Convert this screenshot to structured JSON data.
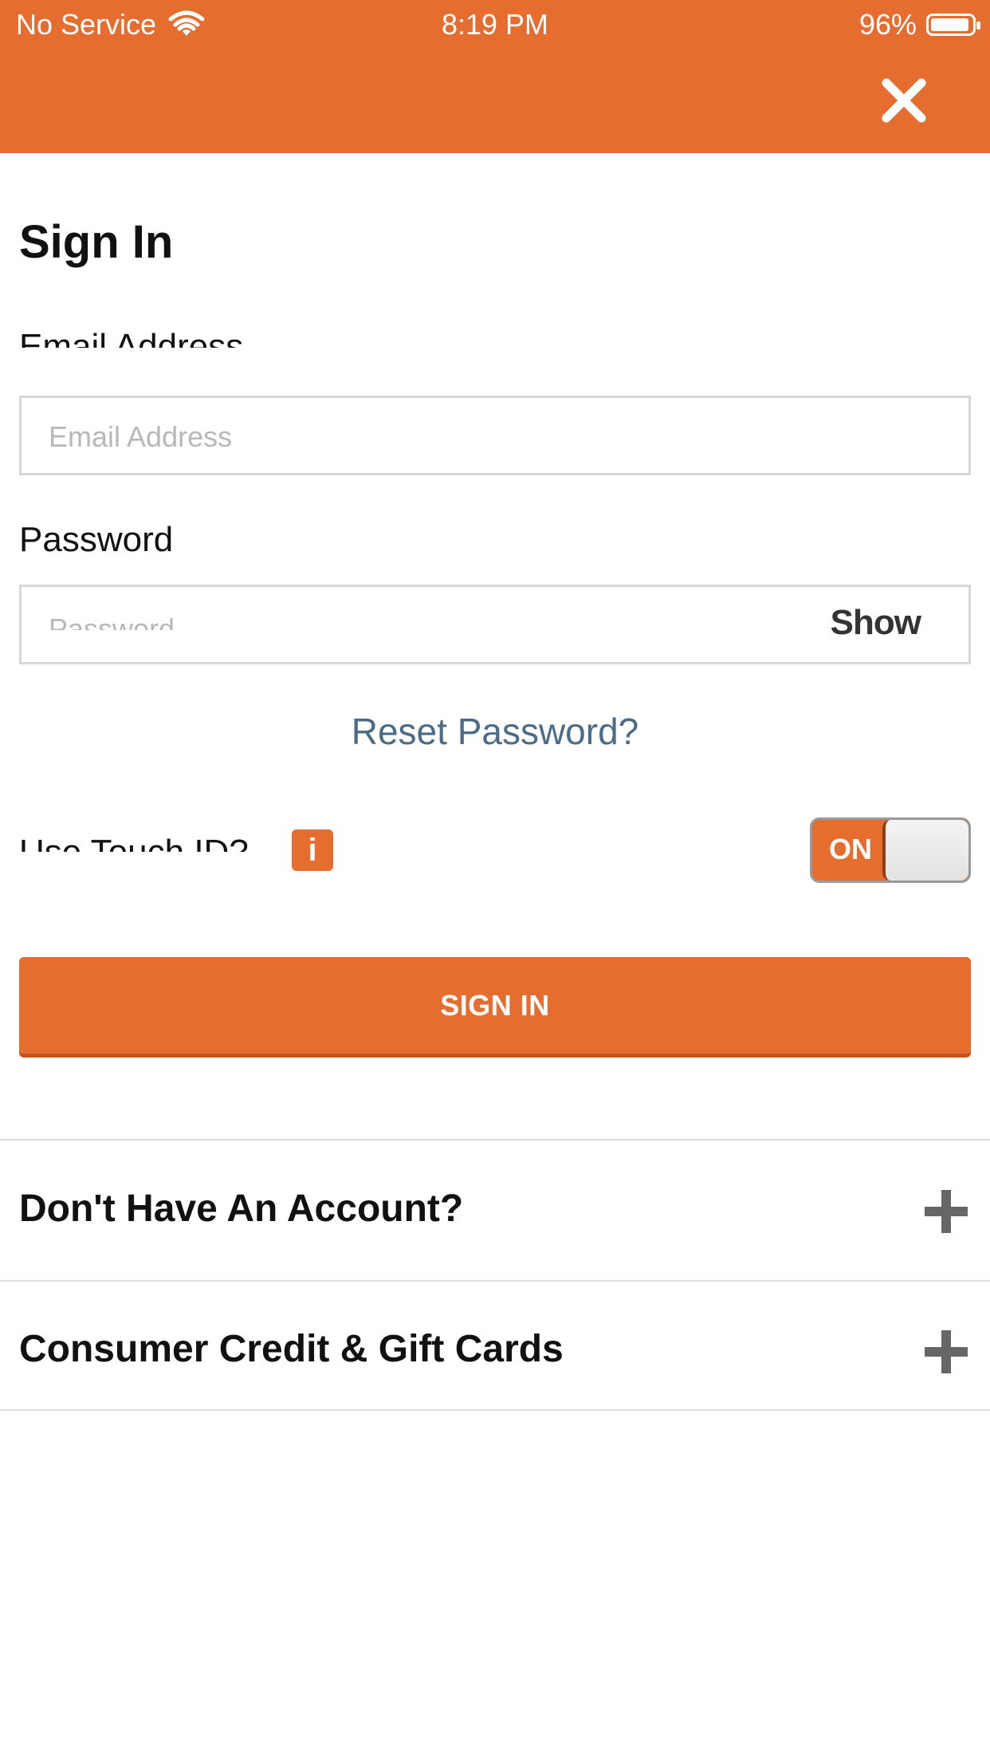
{
  "status_bar": {
    "carrier": "No Service",
    "time": "8:19 PM",
    "battery": "96%"
  },
  "header": {
    "close_icon": "close-icon",
    "accent_color": "#e56d2f"
  },
  "form": {
    "title": "Sign In",
    "email": {
      "label": "Email Address",
      "placeholder": "Email Address",
      "value": ""
    },
    "password": {
      "label": "Password",
      "placeholder": "Password",
      "value": "",
      "show_label": "Show"
    },
    "reset_link": "Reset Password?",
    "touch_id": {
      "label": "Use Touch ID?",
      "info_icon": "i",
      "toggle_state": "ON"
    },
    "submit_label": "SIGN IN"
  },
  "sections": [
    {
      "label": "Don't Have An Account?",
      "icon": "plus-icon"
    },
    {
      "label": "Consumer Credit & Gift Cards",
      "icon": "plus-icon"
    }
  ]
}
